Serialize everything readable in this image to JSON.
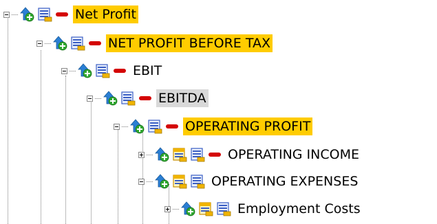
{
  "tree": {
    "nodes": [
      {
        "label": "Net Profit",
        "expander": "minus",
        "highlight": "yellow",
        "icons": [
          "add-child-icon",
          "report-icon",
          "minus-red-icon"
        ]
      },
      {
        "label": "NET PROFIT BEFORE TAX",
        "expander": "minus",
        "highlight": "yellow",
        "icons": [
          "add-child-icon",
          "report-icon",
          "minus-red-icon"
        ]
      },
      {
        "label": "EBIT",
        "expander": "minus",
        "highlight": "none",
        "icons": [
          "add-child-icon",
          "report-icon",
          "minus-red-icon"
        ]
      },
      {
        "label": "EBITDA",
        "expander": "minus",
        "highlight": "gray",
        "icons": [
          "add-child-icon",
          "report-icon",
          "minus-red-icon"
        ]
      },
      {
        "label": "OPERATING PROFIT",
        "expander": "minus",
        "highlight": "yellow",
        "icons": [
          "add-child-icon",
          "report-icon",
          "minus-red-icon"
        ]
      },
      {
        "label": "OPERATING INCOME",
        "expander": "plus",
        "highlight": "none",
        "icons": [
          "add-child-icon",
          "report-yellow-icon",
          "report-icon",
          "minus-red-icon"
        ]
      },
      {
        "label": "OPERATING EXPENSES",
        "expander": "minus",
        "highlight": "none",
        "icons": [
          "add-child-icon",
          "report-yellow-icon",
          "report-icon"
        ]
      },
      {
        "label": "Employment Costs",
        "expander": "plus",
        "highlight": "none",
        "icons": [
          "add-child-icon",
          "report-yellow-icon",
          "report-icon"
        ]
      }
    ]
  },
  "colors": {
    "highlight_yellow": "#ffcc00",
    "highlight_gray": "#d9d9d9",
    "minus_red": "#d40000",
    "arrow_blue": "#2a7fd4",
    "plus_green": "#2fa82f"
  }
}
